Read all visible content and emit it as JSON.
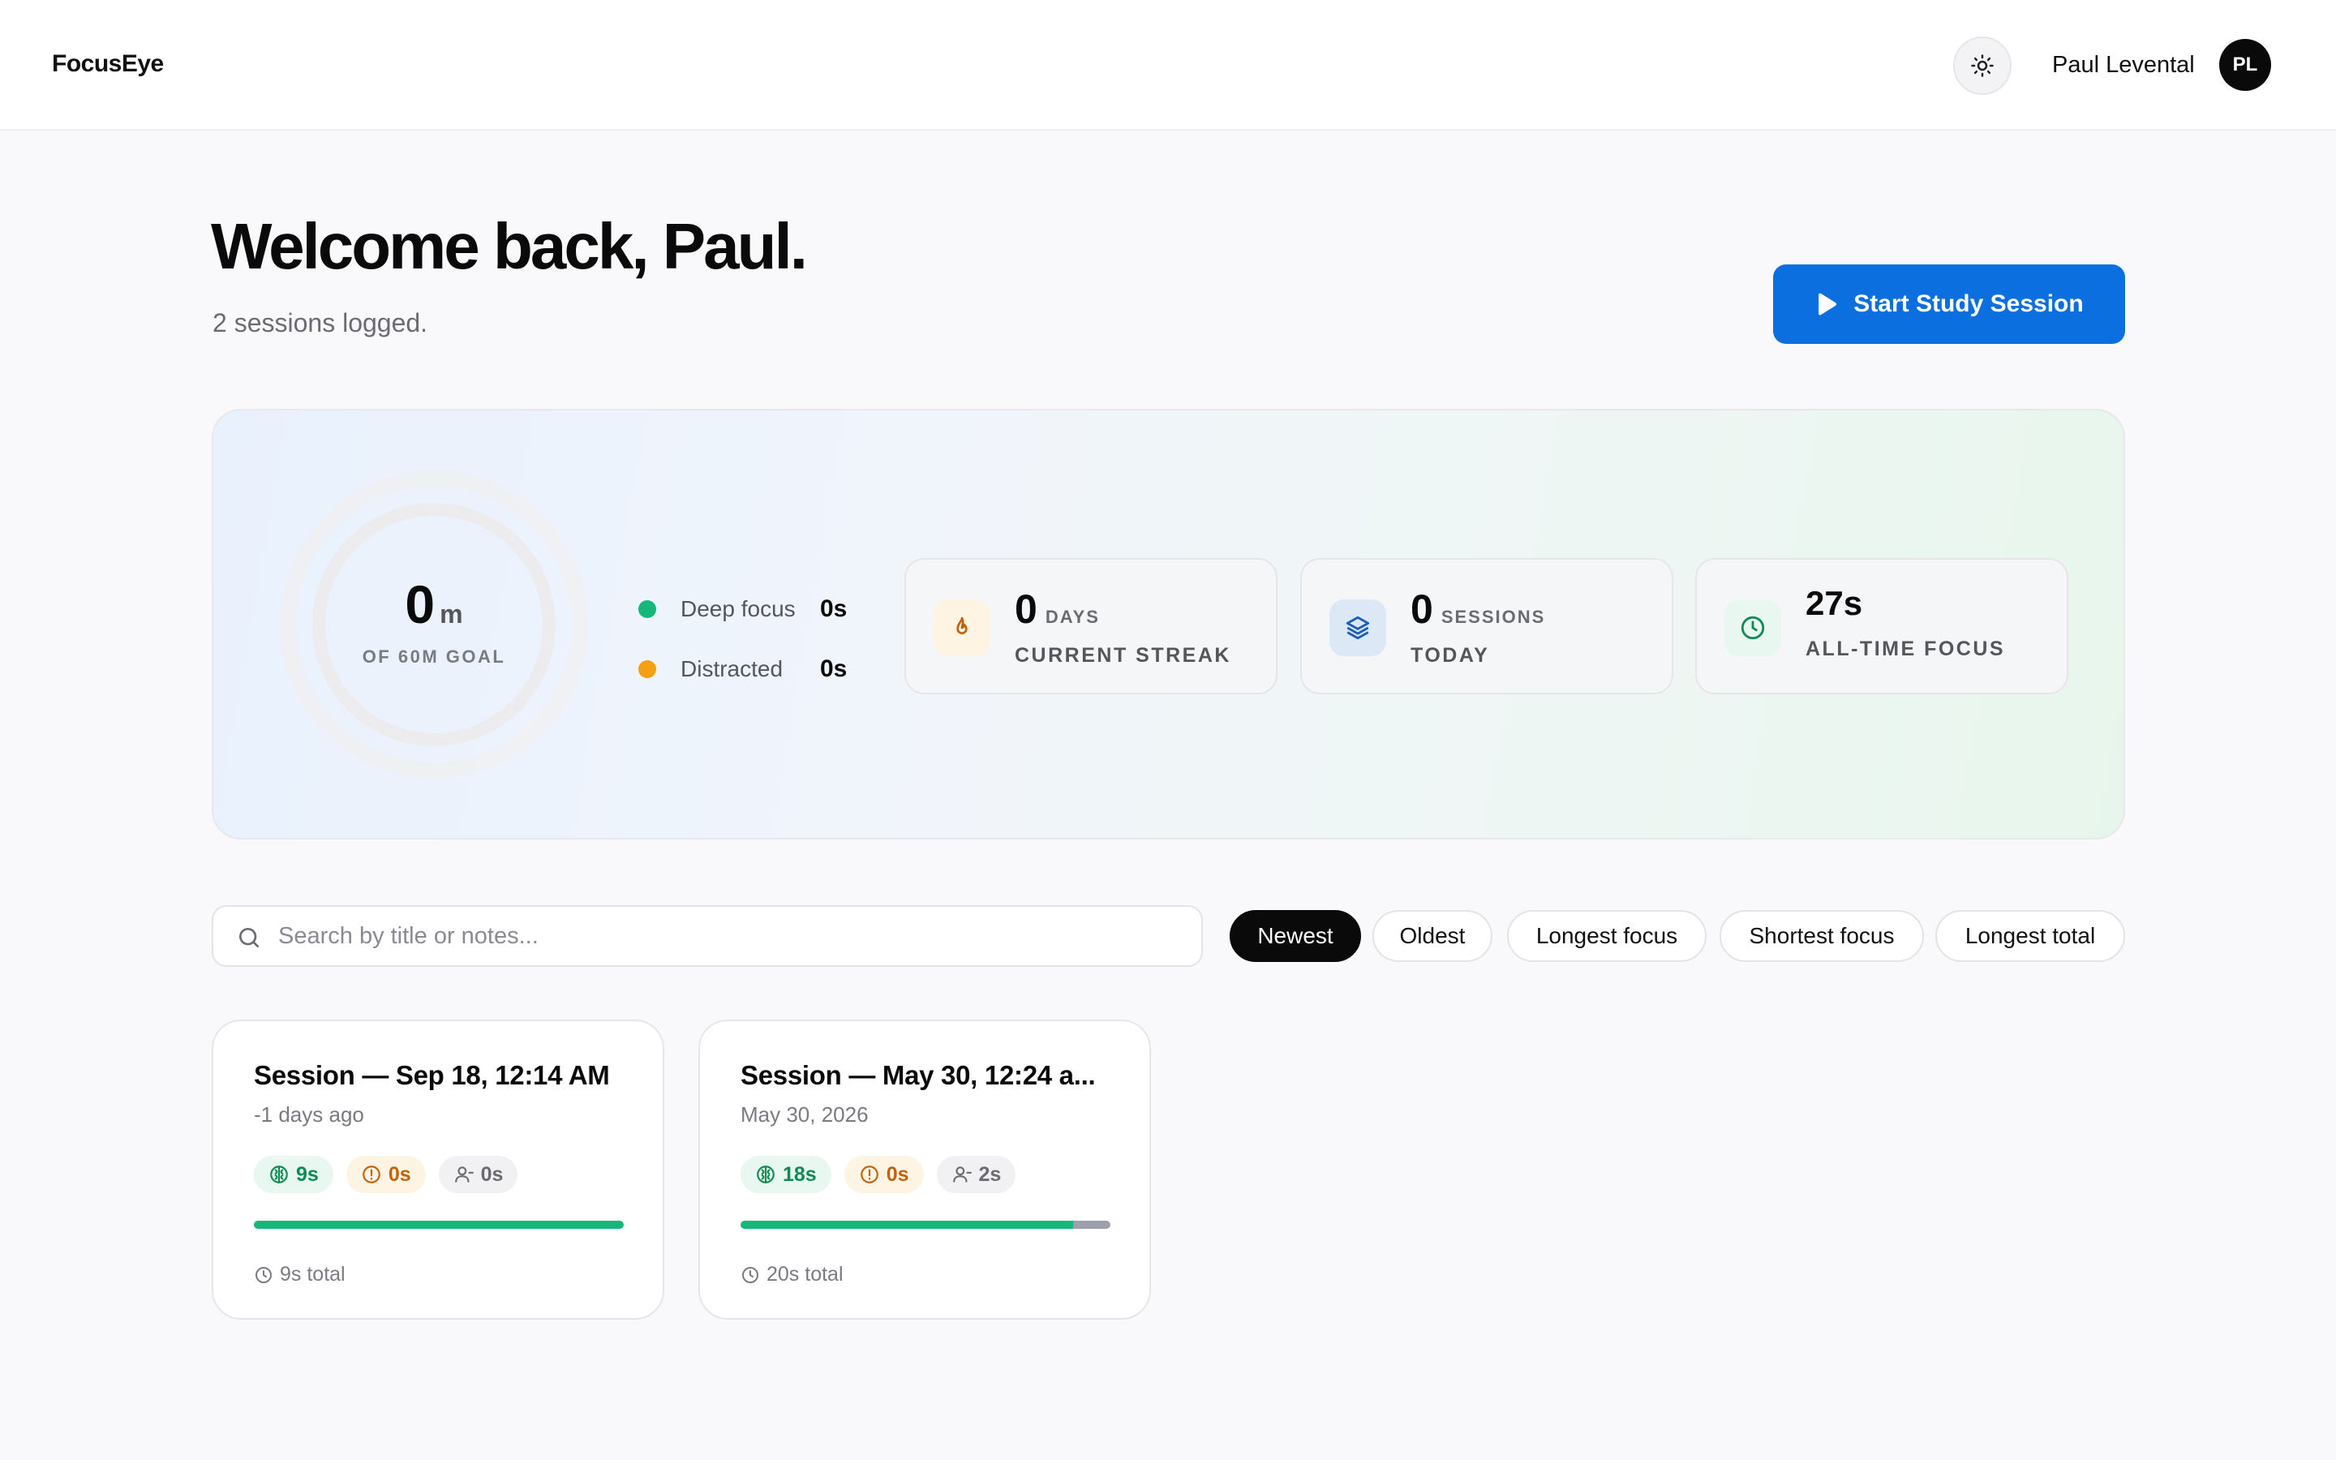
{
  "app": {
    "title": "FocusEye"
  },
  "header": {
    "theme_icon": "sun-icon",
    "user_name": "Paul Levental",
    "avatar_initials": "PL"
  },
  "welcome": {
    "title": "Welcome back, Paul.",
    "subtitle": "2 sessions logged.",
    "start_button_label": "Start Study Session"
  },
  "today": {
    "ring_value": "0",
    "ring_unit": "m",
    "ring_goal_label": "OF 60M GOAL",
    "ring_progress": 0,
    "legend": [
      {
        "label": "Deep focus",
        "value": "0s",
        "color": "#14b87a"
      },
      {
        "label": "Distracted",
        "value": "0s",
        "color": "#f5a013"
      }
    ]
  },
  "stats": [
    {
      "value": "0",
      "unit": "DAYS",
      "label": "CURRENT STREAK",
      "icon": "flame-icon",
      "icon_bg": "#fdf4e3",
      "icon_color": "#c2620c"
    },
    {
      "value": "0",
      "unit": "SESSIONS",
      "label": "TODAY",
      "icon": "layers-icon",
      "icon_bg": "#dde8f6",
      "icon_color": "#1b5fb8"
    },
    {
      "value": "27s",
      "unit": "",
      "label": "ALL-TIME FOCUS",
      "icon": "clock-icon",
      "icon_bg": "#e8f7ef",
      "icon_color": "#0f8a55"
    }
  ],
  "search": {
    "placeholder": "Search by title or notes..."
  },
  "sort_options": [
    "Newest",
    "Oldest",
    "Longest focus",
    "Shortest focus",
    "Longest total"
  ],
  "sort_selected": "Newest",
  "sessions": [
    {
      "title": "Session — Sep 18, 12:14 AM",
      "date": "-1 days ago",
      "focus": "9s",
      "distracted": "0s",
      "away": "0s",
      "focus_fraction": 1.0,
      "total": "9s total"
    },
    {
      "title": "Session — May 30, 12:24 a...",
      "date": "May 30, 2026",
      "focus": "18s",
      "distracted": "0s",
      "away": "2s",
      "focus_fraction": 0.9,
      "total": "20s total"
    }
  ]
}
